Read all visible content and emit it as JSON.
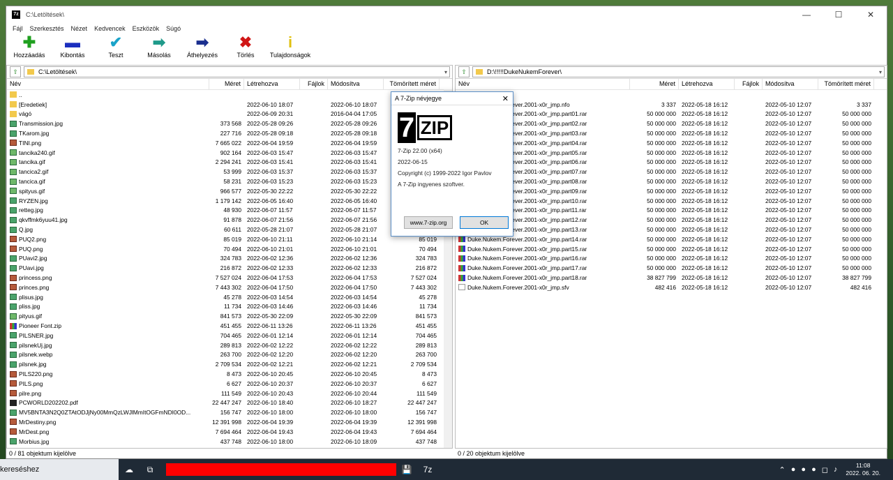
{
  "window": {
    "title": "C:\\Letöltések\\",
    "icon_label": "7z"
  },
  "menu": [
    "Fájl",
    "Szerkesztés",
    "Nézet",
    "Kedvencek",
    "Eszközök",
    "Súgó"
  ],
  "toolbar": [
    {
      "label": "Hozzáadás",
      "icon": "plus-icon",
      "glyph": "✚",
      "color": "#1fa01f"
    },
    {
      "label": "Kibontás",
      "icon": "minus-icon",
      "glyph": "▬",
      "color": "#1b2fbf"
    },
    {
      "label": "Teszt",
      "icon": "check-icon",
      "glyph": "✔",
      "color": "#1aa3c9"
    },
    {
      "label": "Másolás",
      "icon": "copy-arrow-icon",
      "glyph": "➡",
      "color": "#1f9a8a"
    },
    {
      "label": "Áthelyezés",
      "icon": "move-arrow-icon",
      "glyph": "➡",
      "color": "#1b2f8f"
    },
    {
      "label": "Törlés",
      "icon": "delete-x-icon",
      "glyph": "✖",
      "color": "#d01616"
    },
    {
      "label": "Tulajdonságok",
      "icon": "info-icon",
      "glyph": "i",
      "color": "#e0c010"
    }
  ],
  "left": {
    "path": "C:\\Letöltések\\",
    "headers": [
      "Név",
      "Méret",
      "Létrehozva",
      "Fájlok",
      "Módosítva",
      "Tömörített méret"
    ],
    "status": "0 / 81 objektum kijelölve",
    "rows": [
      {
        "name": "..",
        "type": "folder",
        "size": "",
        "created": "",
        "modified": "",
        "packed": ""
      },
      {
        "name": "[Eredetiek]",
        "type": "folder",
        "size": "",
        "created": "2022-06-10 18:07",
        "modified": "2022-06-10 18:07",
        "packed": ""
      },
      {
        "name": "vágó",
        "type": "folder",
        "size": "",
        "created": "2022-06-09 20:31",
        "modified": "2016-04-04 17:05",
        "packed": ""
      },
      {
        "name": "Transmission.jpg",
        "type": "img",
        "size": "373 568",
        "created": "2022-05-28 09:26",
        "modified": "2022-05-28 09:26",
        "packed": "373 568"
      },
      {
        "name": "TKarom.jpg",
        "type": "img",
        "size": "227 716",
        "created": "2022-05-28 09:18",
        "modified": "2022-05-28 09:18",
        "packed": "227 716"
      },
      {
        "name": "TINI.png",
        "type": "png",
        "size": "7 665 022",
        "created": "2022-06-04 19:59",
        "modified": "2022-06-04 19:59",
        "packed": "7 665 022"
      },
      {
        "name": "tancika240.gif",
        "type": "gif",
        "size": "902 164",
        "created": "2022-06-03 15:47",
        "modified": "2022-06-03 15:47",
        "packed": "902 164"
      },
      {
        "name": "tancika.gif",
        "type": "gif",
        "size": "2 294 241",
        "created": "2022-06-03 15:41",
        "modified": "2022-06-03 15:41",
        "packed": "2 294 241"
      },
      {
        "name": "tancica2.gif",
        "type": "gif",
        "size": "53 999",
        "created": "2022-06-03 15:37",
        "modified": "2022-06-03 15:37",
        "packed": "53 999"
      },
      {
        "name": "tancica.gif",
        "type": "gif",
        "size": "58 231",
        "created": "2022-06-03 15:23",
        "modified": "2022-06-03 15:23",
        "packed": "58 231"
      },
      {
        "name": "spityus.gif",
        "type": "gif",
        "size": "966 577",
        "created": "2022-05-30 22:22",
        "modified": "2022-05-30 22:22",
        "packed": "966 577"
      },
      {
        "name": "RYZEN.jpg",
        "type": "img",
        "size": "1 179 142",
        "created": "2022-06-05 16:40",
        "modified": "2022-06-05 16:40",
        "packed": "1 179 142"
      },
      {
        "name": "retteg.jpg",
        "type": "img",
        "size": "48 930",
        "created": "2022-06-07 11:57",
        "modified": "2022-06-07 11:57",
        "packed": "48 930"
      },
      {
        "name": "qkvffmk6yuu41.jpg",
        "type": "img",
        "size": "91 878",
        "created": "2022-06-07 21:56",
        "modified": "2022-06-07 21:56",
        "packed": "91 878"
      },
      {
        "name": "Q.jpg",
        "type": "img",
        "size": "60 611",
        "created": "2022-05-28 21:07",
        "modified": "2022-05-28 21:07",
        "packed": "60 611"
      },
      {
        "name": "PUQ2.png",
        "type": "png",
        "size": "85 019",
        "created": "2022-06-10 21:11",
        "modified": "2022-06-10 21:14",
        "packed": "85 019"
      },
      {
        "name": "PUQ.png",
        "type": "png",
        "size": "70 494",
        "created": "2022-06-10 21:01",
        "modified": "2022-06-10 21:01",
        "packed": "70 494"
      },
      {
        "name": "PUavi2.jpg",
        "type": "img",
        "size": "324 783",
        "created": "2022-06-02 12:36",
        "modified": "2022-06-02 12:36",
        "packed": "324 783"
      },
      {
        "name": "PUavi.jpg",
        "type": "img",
        "size": "216 872",
        "created": "2022-06-02 12:33",
        "modified": "2022-06-02 12:33",
        "packed": "216 872"
      },
      {
        "name": "princess.png",
        "type": "png",
        "size": "7 527 024",
        "created": "2022-06-04 17:53",
        "modified": "2022-06-04 17:53",
        "packed": "7 527 024"
      },
      {
        "name": "princes.png",
        "type": "png",
        "size": "7 443 302",
        "created": "2022-06-04 17:50",
        "modified": "2022-06-04 17:50",
        "packed": "7 443 302"
      },
      {
        "name": "plisus.jpg",
        "type": "img",
        "size": "45 278",
        "created": "2022-06-03 14:54",
        "modified": "2022-06-03 14:54",
        "packed": "45 278"
      },
      {
        "name": "pliss.jpg",
        "type": "img",
        "size": "11 734",
        "created": "2022-06-03 14:46",
        "modified": "2022-06-03 14:46",
        "packed": "11 734"
      },
      {
        "name": "pityus.gif",
        "type": "gif",
        "size": "841 573",
        "created": "2022-05-30 22:09",
        "modified": "2022-05-30 22:09",
        "packed": "841 573"
      },
      {
        "name": "Pioneer Font.zip",
        "type": "zip",
        "size": "451 455",
        "created": "2022-06-11 13:26",
        "modified": "2022-06-11 13:26",
        "packed": "451 455"
      },
      {
        "name": "PILSNER.jpg",
        "type": "img",
        "size": "704 465",
        "created": "2022-06-01 12:14",
        "modified": "2022-06-01 12:14",
        "packed": "704 465"
      },
      {
        "name": "pilsnekUj.jpg",
        "type": "img",
        "size": "289 813",
        "created": "2022-06-02 12:22",
        "modified": "2022-06-02 12:22",
        "packed": "289 813"
      },
      {
        "name": "pilsnek.webp",
        "type": "img",
        "size": "263 700",
        "created": "2022-06-02 12:20",
        "modified": "2022-06-02 12:20",
        "packed": "263 700"
      },
      {
        "name": "pilsnek.jpg",
        "type": "img",
        "size": "2 709 534",
        "created": "2022-06-02 12:21",
        "modified": "2022-06-02 12:21",
        "packed": "2 709 534"
      },
      {
        "name": "PILS220.png",
        "type": "png",
        "size": "8 473",
        "created": "2022-06-10 20:45",
        "modified": "2022-06-10 20:45",
        "packed": "8 473"
      },
      {
        "name": "PILS.png",
        "type": "png",
        "size": "6 627",
        "created": "2022-06-10 20:37",
        "modified": "2022-06-10 20:37",
        "packed": "6 627"
      },
      {
        "name": "pilre.png",
        "type": "png",
        "size": "111 549",
        "created": "2022-06-10 20:43",
        "modified": "2022-06-10 20:44",
        "packed": "111 549"
      },
      {
        "name": "PCWORLD202202.pdf",
        "type": "pdf",
        "size": "22 447 247",
        "created": "2022-06-10 18:40",
        "modified": "2022-06-10 18:27",
        "packed": "22 447 247"
      },
      {
        "name": "MV5BNTA3N2Q0ZTAtODJjNy00MmQzLWJlMmItOGFmNDI0OD...",
        "type": "img",
        "size": "156 747",
        "created": "2022-06-10 18:00",
        "modified": "2022-06-10 18:00",
        "packed": "156 747"
      },
      {
        "name": "MrDestiny.png",
        "type": "png",
        "size": "12 391 998",
        "created": "2022-06-04 19:39",
        "modified": "2022-06-04 19:39",
        "packed": "12 391 998"
      },
      {
        "name": "MrDest.png",
        "type": "png",
        "size": "7 694 464",
        "created": "2022-06-04 19:43",
        "modified": "2022-06-04 19:43",
        "packed": "7 694 464"
      },
      {
        "name": "Morbius.jpg",
        "type": "img",
        "size": "437 748",
        "created": "2022-06-10 18:00",
        "modified": "2022-06-10 18:09",
        "packed": "437 748"
      }
    ]
  },
  "right": {
    "path": "D:\\!!!!!DukeNukemForever\\",
    "headers": [
      "Név",
      "Méret",
      "Létrehozva",
      "Fájlok",
      "Módosítva",
      "Tömörített méret"
    ],
    "status": "0 / 20 objektum kijelölve",
    "rows": [
      {
        "name": "..",
        "type": "folder",
        "size": "",
        "created": "",
        "modified": "",
        "packed": ""
      },
      {
        "name": "Duke.Nukem.Forever.2001-x0r_jmp.nfo",
        "type": "file",
        "size": "3 337",
        "created": "2022-05-18 16:12",
        "modified": "2022-05-10 12:07",
        "packed": "3 337"
      },
      {
        "name": "Duke.Nukem.Forever.2001-x0r_jmp.part01.rar",
        "type": "rar",
        "size": "50 000 000",
        "created": "2022-05-18 16:12",
        "modified": "2022-05-10 12:07",
        "packed": "50 000 000"
      },
      {
        "name": "Duke.Nukem.Forever.2001-x0r_jmp.part02.rar",
        "type": "rar",
        "size": "50 000 000",
        "created": "2022-05-18 16:12",
        "modified": "2022-05-10 12:07",
        "packed": "50 000 000"
      },
      {
        "name": "Duke.Nukem.Forever.2001-x0r_jmp.part03.rar",
        "type": "rar",
        "size": "50 000 000",
        "created": "2022-05-18 16:12",
        "modified": "2022-05-10 12:07",
        "packed": "50 000 000"
      },
      {
        "name": "Duke.Nukem.Forever.2001-x0r_jmp.part04.rar",
        "type": "rar",
        "size": "50 000 000",
        "created": "2022-05-18 16:12",
        "modified": "2022-05-10 12:07",
        "packed": "50 000 000"
      },
      {
        "name": "Duke.Nukem.Forever.2001-x0r_jmp.part05.rar",
        "type": "rar",
        "size": "50 000 000",
        "created": "2022-05-18 16:12",
        "modified": "2022-05-10 12:07",
        "packed": "50 000 000"
      },
      {
        "name": "Duke.Nukem.Forever.2001-x0r_jmp.part06.rar",
        "type": "rar",
        "size": "50 000 000",
        "created": "2022-05-18 16:12",
        "modified": "2022-05-10 12:07",
        "packed": "50 000 000"
      },
      {
        "name": "Duke.Nukem.Forever.2001-x0r_jmp.part07.rar",
        "type": "rar",
        "size": "50 000 000",
        "created": "2022-05-18 16:12",
        "modified": "2022-05-10 12:07",
        "packed": "50 000 000"
      },
      {
        "name": "Duke.Nukem.Forever.2001-x0r_jmp.part08.rar",
        "type": "rar",
        "size": "50 000 000",
        "created": "2022-05-18 16:12",
        "modified": "2022-05-10 12:07",
        "packed": "50 000 000"
      },
      {
        "name": "Duke.Nukem.Forever.2001-x0r_jmp.part09.rar",
        "type": "rar",
        "size": "50 000 000",
        "created": "2022-05-18 16:12",
        "modified": "2022-05-10 12:07",
        "packed": "50 000 000"
      },
      {
        "name": "Duke.Nukem.Forever.2001-x0r_jmp.part10.rar",
        "type": "rar",
        "size": "50 000 000",
        "created": "2022-05-18 16:12",
        "modified": "2022-05-10 12:07",
        "packed": "50 000 000"
      },
      {
        "name": "Duke.Nukem.Forever.2001-x0r_jmp.part11.rar",
        "type": "rar",
        "size": "50 000 000",
        "created": "2022-05-18 16:12",
        "modified": "2022-05-10 12:07",
        "packed": "50 000 000"
      },
      {
        "name": "Duke.Nukem.Forever.2001-x0r_jmp.part12.rar",
        "type": "rar",
        "size": "50 000 000",
        "created": "2022-05-18 16:12",
        "modified": "2022-05-10 12:07",
        "packed": "50 000 000"
      },
      {
        "name": "Duke.Nukem.Forever.2001-x0r_jmp.part13.rar",
        "type": "rar",
        "size": "50 000 000",
        "created": "2022-05-18 16:12",
        "modified": "2022-05-10 12:07",
        "packed": "50 000 000"
      },
      {
        "name": "Duke.Nukem.Forever.2001-x0r_jmp.part14.rar",
        "type": "rar",
        "size": "50 000 000",
        "created": "2022-05-18 16:12",
        "modified": "2022-05-10 12:07",
        "packed": "50 000 000"
      },
      {
        "name": "Duke.Nukem.Forever.2001-x0r_jmp.part15.rar",
        "type": "rar",
        "size": "50 000 000",
        "created": "2022-05-18 16:12",
        "modified": "2022-05-10 12:07",
        "packed": "50 000 000"
      },
      {
        "name": "Duke.Nukem.Forever.2001-x0r_jmp.part16.rar",
        "type": "rar",
        "size": "50 000 000",
        "created": "2022-05-18 16:12",
        "modified": "2022-05-10 12:07",
        "packed": "50 000 000"
      },
      {
        "name": "Duke.Nukem.Forever.2001-x0r_jmp.part17.rar",
        "type": "rar",
        "size": "50 000 000",
        "created": "2022-05-18 16:12",
        "modified": "2022-05-10 12:07",
        "packed": "50 000 000"
      },
      {
        "name": "Duke.Nukem.Forever.2001-x0r_jmp.part18.rar",
        "type": "rar",
        "size": "38 827 799",
        "created": "2022-05-18 16:12",
        "modified": "2022-05-10 12:07",
        "packed": "38 827 799"
      },
      {
        "name": "Duke.Nukem.Forever.2001-x0r_jmp.sfv",
        "type": "file",
        "size": "482 416",
        "created": "2022-05-18 16:12",
        "modified": "2022-05-10 12:07",
        "packed": "482 416"
      }
    ]
  },
  "dialog": {
    "title": "A 7-Zip névjegye",
    "logo_seven": "7",
    "logo_zip": "ZIP",
    "version": "7-Zip 22.00 (x64)",
    "date": "2022-06-15",
    "copyright": "Copyright (c) 1999-2022 Igor Pavlov",
    "license": "A 7-Zip ingyenes szoftver.",
    "website_button": "www.7-zip.org",
    "ok_button": "OK"
  },
  "taskbar": {
    "search_text": "kereséshez",
    "clock_time": "11:08",
    "clock_date": "2022. 06. 20.",
    "app_label": "7z"
  }
}
